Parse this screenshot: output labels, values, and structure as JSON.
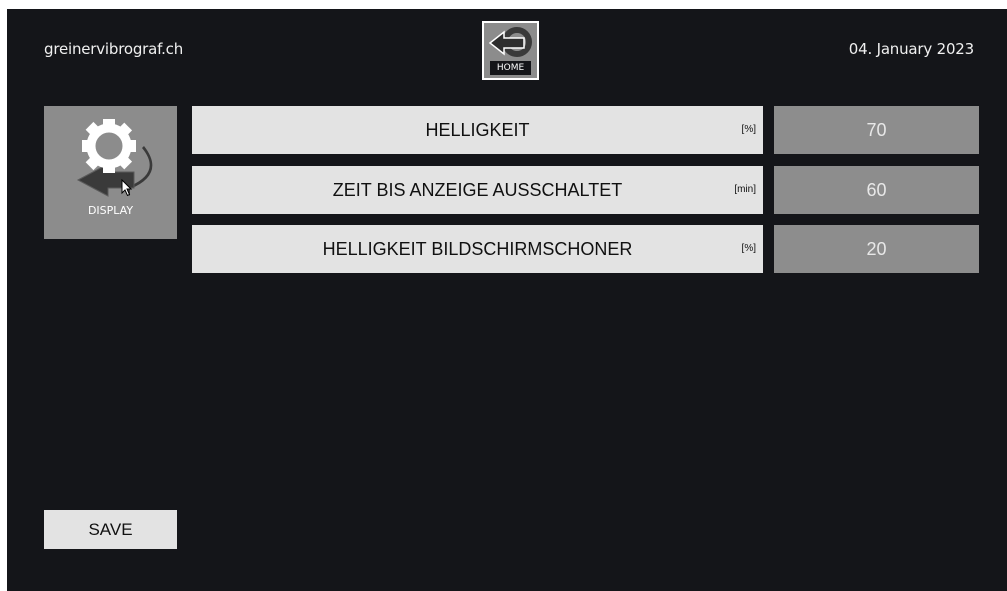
{
  "header": {
    "brand": "greinervibrograf.ch",
    "date": "04. January 2023",
    "home_label": "HOME"
  },
  "sidebar": {
    "display_label": "DISPLAY"
  },
  "settings": [
    {
      "label": "HELLIGKEIT",
      "unit": "[%]",
      "value": "70"
    },
    {
      "label": "ZEIT BIS ANZEIGE AUSSCHALTET",
      "unit": "[min]",
      "value": "60"
    },
    {
      "label": "HELLIGKEIT BILDSCHIRMSCHONER",
      "unit": "[%]",
      "value": "20"
    }
  ],
  "footer": {
    "save_label": "SAVE"
  },
  "icons": {
    "home": "back-arrow-icon",
    "display": "gear-icon"
  },
  "colors": {
    "background": "#141519",
    "tile": "#8c8c8c",
    "label_bg": "#e3e3e3",
    "value_bg": "#8d8d8d"
  }
}
